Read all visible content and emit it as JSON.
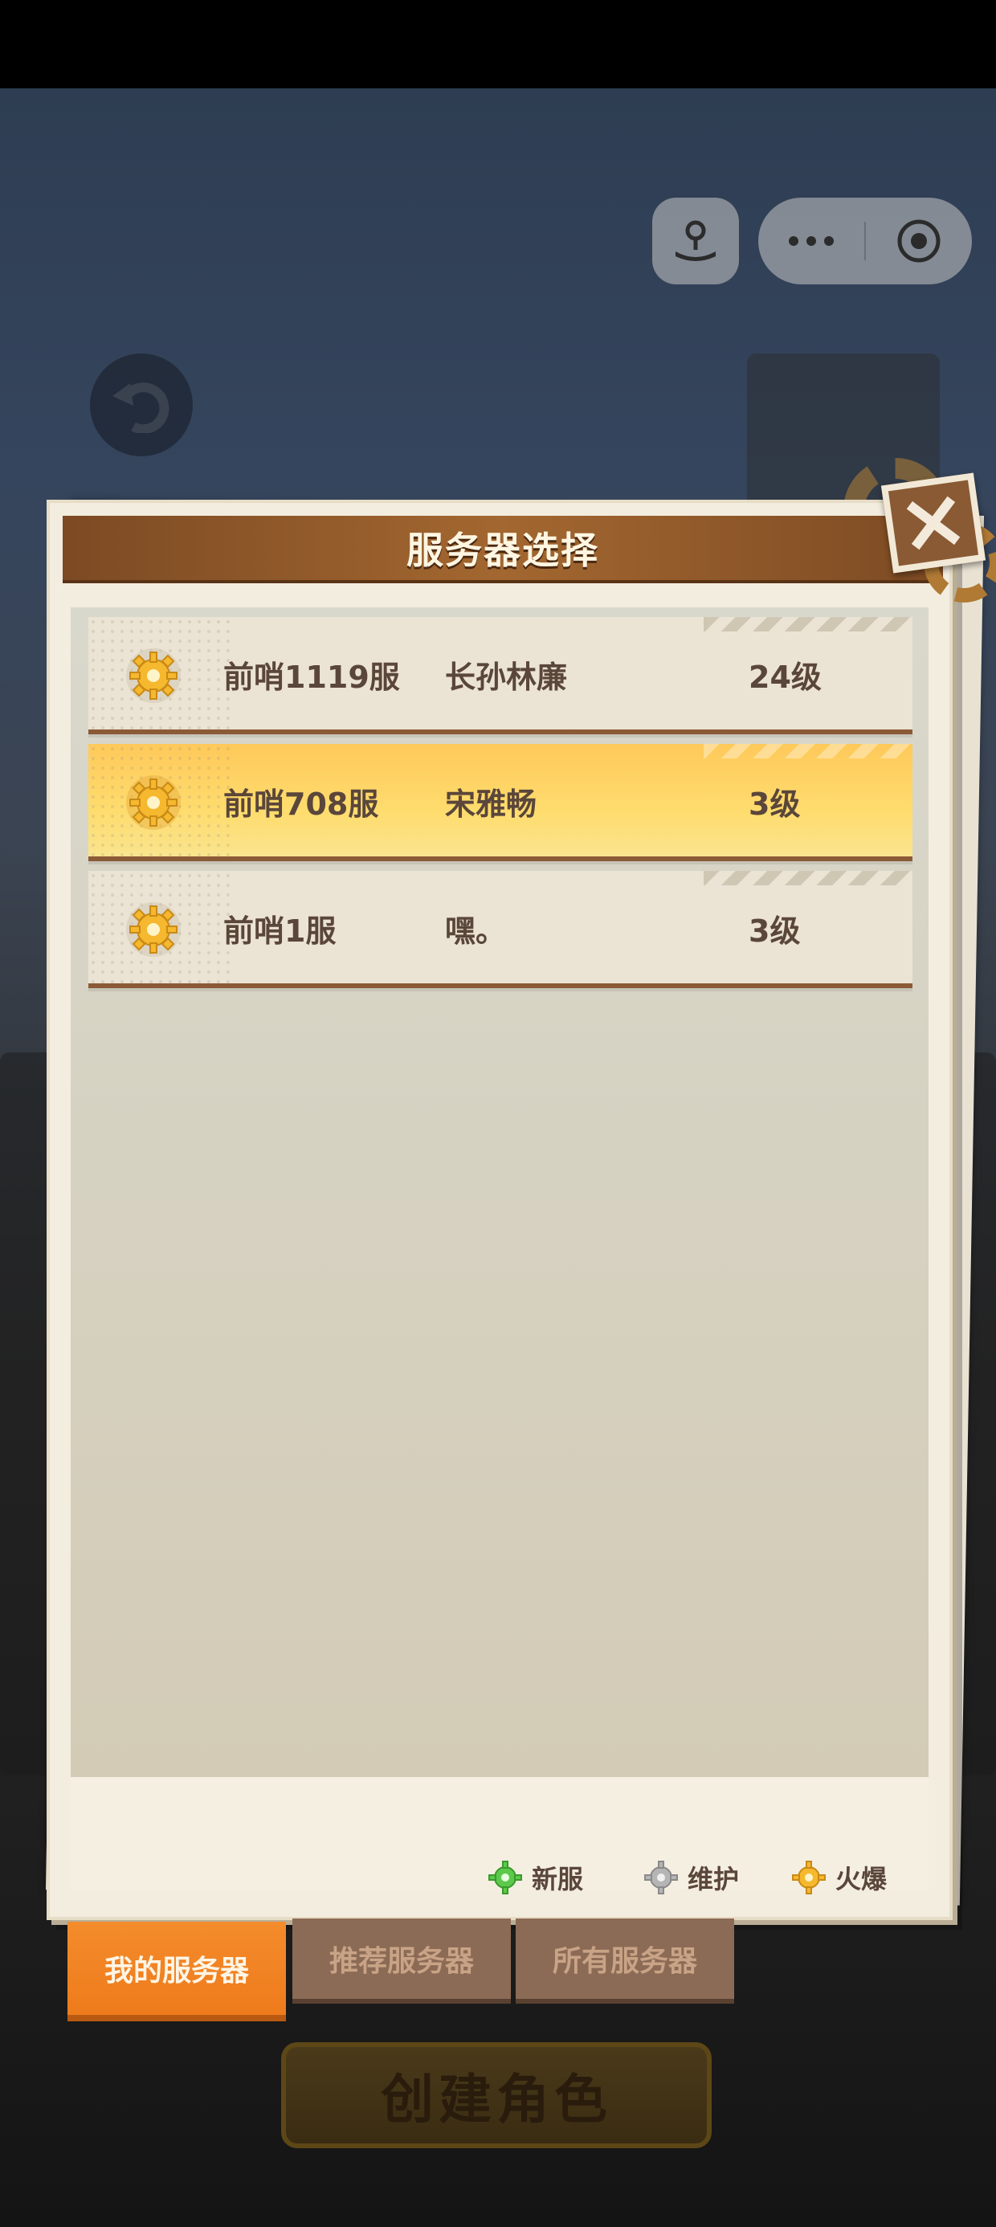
{
  "window": {
    "title": "服务器选择"
  },
  "servers": [
    {
      "server": "前哨1119服",
      "name": "长孙林廉",
      "level": "24级",
      "status_icon": "hot-gear-icon",
      "selected": false
    },
    {
      "server": "前哨708服",
      "name": "宋雅畅",
      "level": "3级",
      "status_icon": "hot-gear-icon",
      "selected": true
    },
    {
      "server": "前哨1服",
      "name": "嘿。",
      "level": "3级",
      "status_icon": "hot-gear-icon",
      "selected": false
    }
  ],
  "legend": [
    {
      "label": "新服",
      "icon": "green-gear-icon",
      "color": "#5cc94a"
    },
    {
      "label": "维护",
      "icon": "gray-gear-icon",
      "color": "#a8a8a8"
    },
    {
      "label": "火爆",
      "icon": "yellow-gear-icon",
      "color": "#f5b82e"
    }
  ],
  "tabs": [
    {
      "label": "我的服务器",
      "active": true
    },
    {
      "label": "推荐服务器",
      "active": false
    },
    {
      "label": "所有服务器",
      "active": false
    }
  ],
  "create_button": {
    "label": "创建角色"
  },
  "colors": {
    "accent": "#ee7b1c",
    "header": "#8b5a2b",
    "selected_row": "#fed46a"
  }
}
